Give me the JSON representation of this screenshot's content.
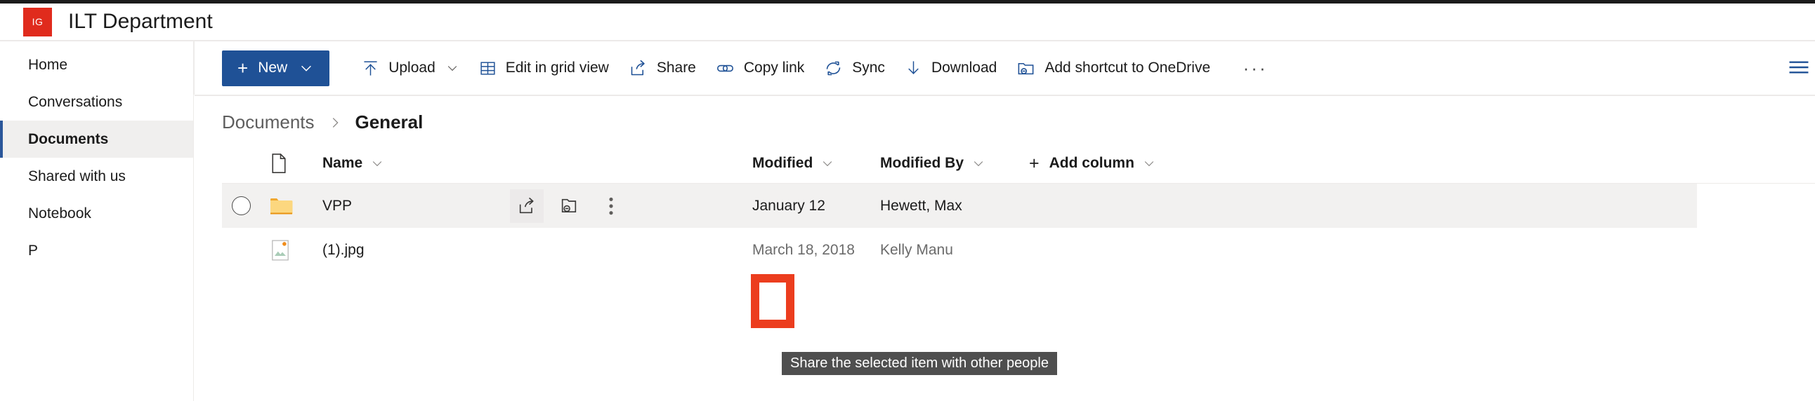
{
  "header": {
    "logo_initials": "IG",
    "logo_color": "#e02b1d",
    "site_title": "ILT Department"
  },
  "sidebar": {
    "items": [
      {
        "label": "Home",
        "selected": false
      },
      {
        "label": "Conversations",
        "selected": false
      },
      {
        "label": "Documents",
        "selected": true
      },
      {
        "label": "Shared with us",
        "selected": false
      },
      {
        "label": "Notebook",
        "selected": false
      },
      {
        "label": "P",
        "selected": false
      }
    ],
    "selected_accent": "#2b579a"
  },
  "command_bar": {
    "new_label": "New",
    "new_button_color": "#1f5196",
    "items": [
      {
        "label": "Upload",
        "icon": "upload-icon",
        "has_chevron": true
      },
      {
        "label": "Edit in grid view",
        "icon": "grid-view-icon",
        "has_chevron": false
      },
      {
        "label": "Share",
        "icon": "share-icon",
        "has_chevron": false
      },
      {
        "label": "Copy link",
        "icon": "copy-link-icon",
        "has_chevron": false
      },
      {
        "label": "Sync",
        "icon": "sync-icon",
        "has_chevron": false
      },
      {
        "label": "Download",
        "icon": "download-icon",
        "has_chevron": false
      },
      {
        "label": "Add shortcut to OneDrive",
        "icon": "add-shortcut-icon",
        "has_chevron": false
      }
    ],
    "overflow_label": "···",
    "view_options_icon": "list-view-icon"
  },
  "breadcrumb": {
    "parent": "Documents",
    "separator": "›",
    "current": "General"
  },
  "list": {
    "columns": [
      {
        "label": "Name",
        "has_chevron": true
      },
      {
        "label": "Modified",
        "has_chevron": true
      },
      {
        "label": "Modified By",
        "has_chevron": true
      }
    ],
    "add_column_label": "Add column",
    "file_type_header_icon": "document-icon",
    "rows": [
      {
        "name": "VPP",
        "icon": "folder-icon",
        "modified": "January 12",
        "modified_by": "Hewett, Max",
        "selected": true,
        "actions": [
          "share-icon",
          "copy-link-icon",
          "more-actions-icon"
        ]
      },
      {
        "name": "(1).jpg",
        "icon": "image-file-icon",
        "modified": "March 18, 2018",
        "modified_by": "Kelly Manu",
        "selected": false,
        "actions": []
      }
    ]
  },
  "tooltip": {
    "text": "Share the selected item with other people"
  },
  "highlight": {
    "color": "#ec3d1e",
    "target": "share-row-action"
  }
}
